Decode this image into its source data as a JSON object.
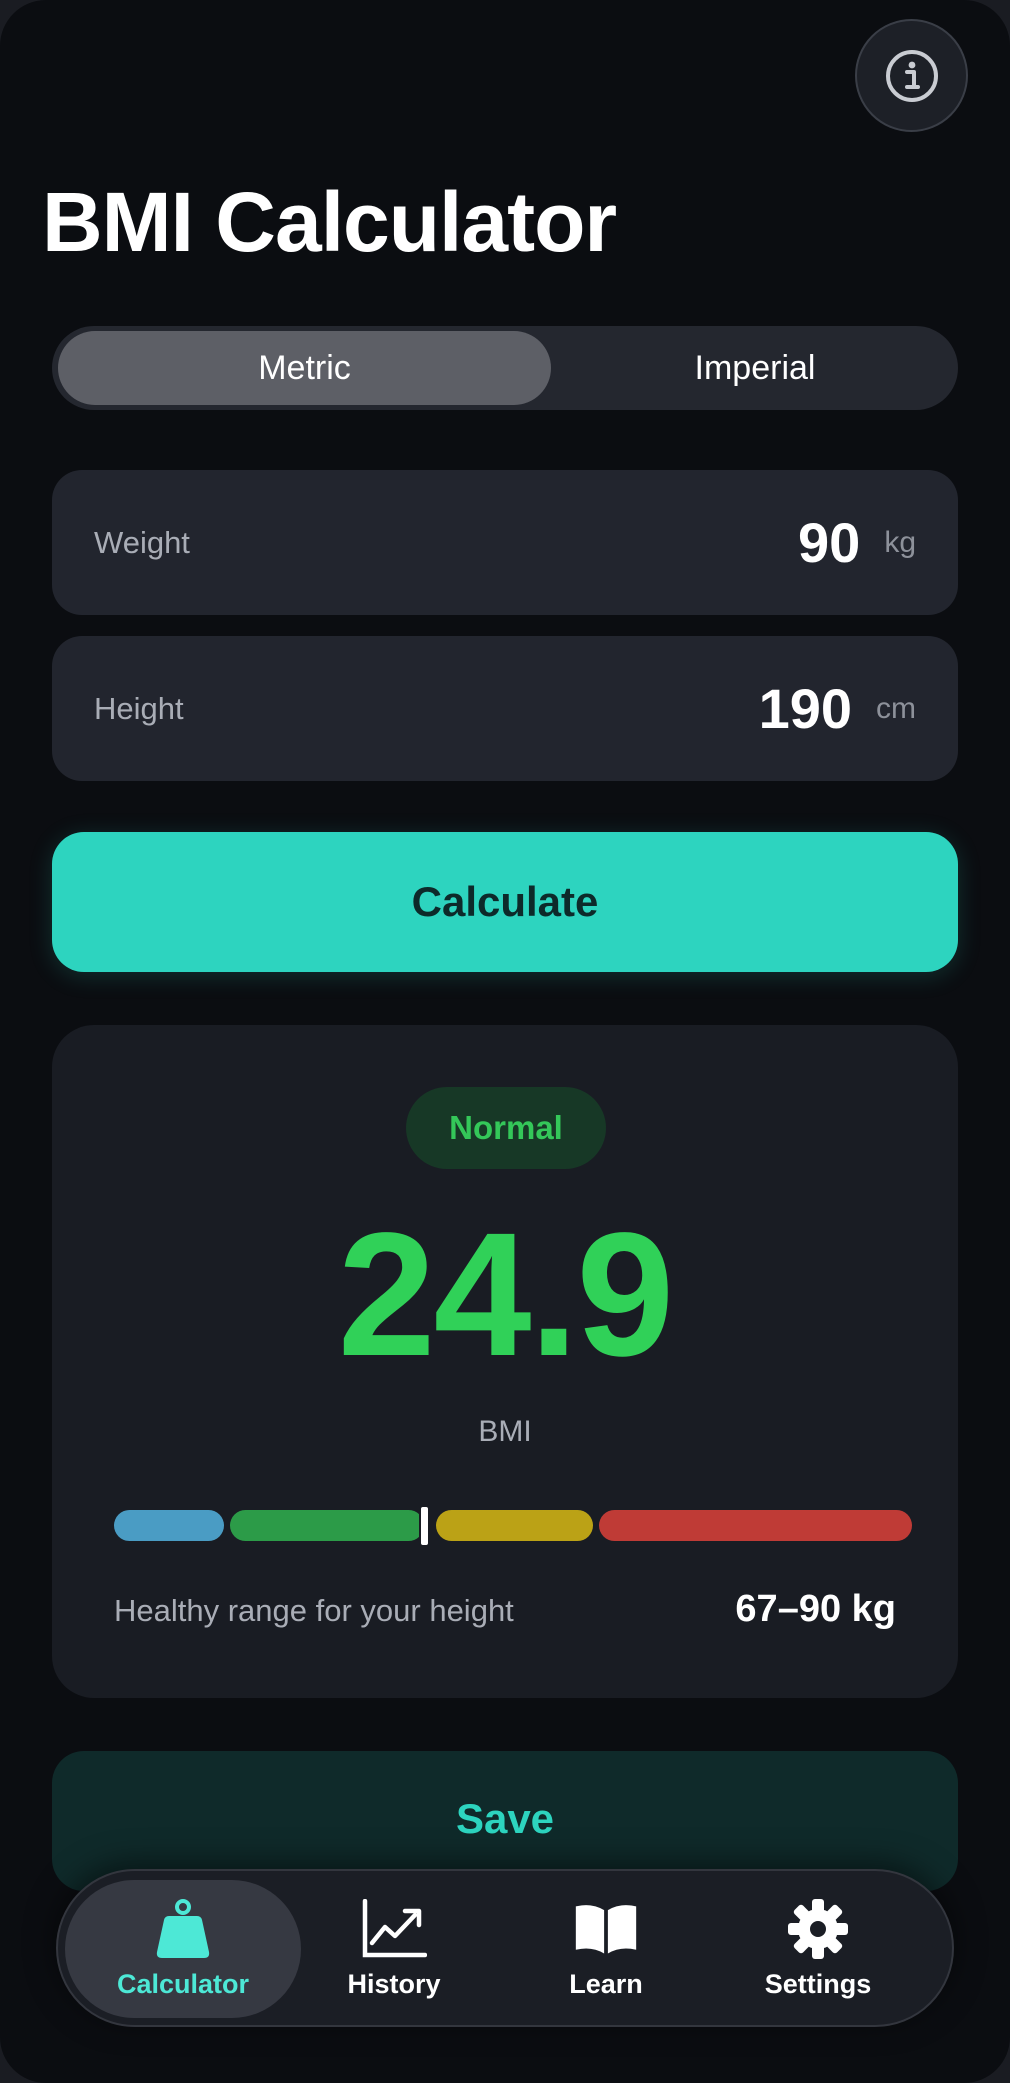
{
  "header": {
    "title": "BMI Calculator",
    "info_icon": "info-icon"
  },
  "units": {
    "options": [
      "Metric",
      "Imperial"
    ],
    "selected": "Metric"
  },
  "inputs": {
    "weight": {
      "label": "Weight",
      "value": "90",
      "unit": "kg"
    },
    "height": {
      "label": "Height",
      "value": "190",
      "unit": "cm"
    }
  },
  "calculate_label": "Calculate",
  "result": {
    "status": "Normal",
    "bmi_value": "24.9",
    "bmi_label": "BMI",
    "scale": {
      "marker_bmi": 24.9,
      "categories": [
        {
          "name": "underweight",
          "color": "#4a9cc4"
        },
        {
          "name": "normal",
          "color": "#2c9b48"
        },
        {
          "name": "overweight",
          "color": "#bba216"
        },
        {
          "name": "obese",
          "color": "#bf3b36"
        }
      ]
    },
    "healthy_range_label": "Healthy range for your height",
    "healthy_range_value": "67–90 kg"
  },
  "save_label": "Save",
  "tabs": [
    {
      "label": "Calculator",
      "icon": "weight-icon",
      "active": true
    },
    {
      "label": "History",
      "icon": "chart-line-icon",
      "active": false
    },
    {
      "label": "Learn",
      "icon": "book-icon",
      "active": false
    },
    {
      "label": "Settings",
      "icon": "gear-icon",
      "active": false
    }
  ],
  "colors": {
    "accent": "#2dd4bf",
    "status_normal": "#30d158",
    "background": "#0b0d11",
    "card": "#22252e"
  }
}
